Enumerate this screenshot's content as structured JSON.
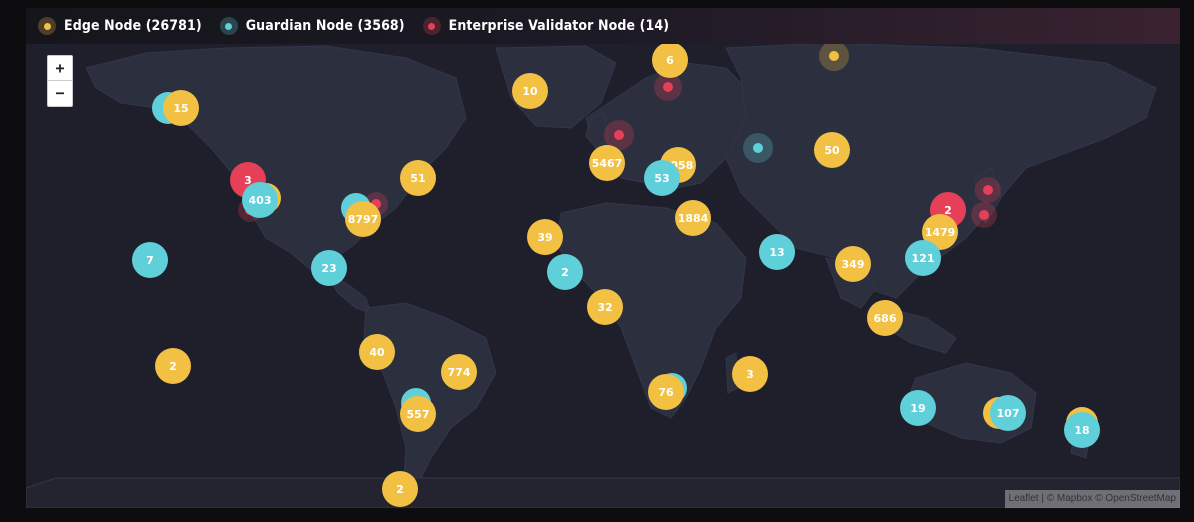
{
  "legend": [
    {
      "label": "Edge Node (26781)",
      "color": "#f2c043",
      "icon": "dot-icon"
    },
    {
      "label": "Guardian Node (3568)",
      "color": "#5fcfd9",
      "icon": "dot-icon"
    },
    {
      "label": "Enterprise Validator Node (14)",
      "color": "#e64058",
      "icon": "dot-icon"
    }
  ],
  "zoom": {
    "in_label": "+",
    "out_label": "−"
  },
  "attribution": {
    "leaflet": "Leaflet",
    "sep": " | © ",
    "mapbox": "Mapbox",
    "osm_prefix": " © ",
    "osm": "OpenStreetMap"
  },
  "colors": {
    "edge": "#f2c043",
    "guardian": "#5fcfd9",
    "validator": "#e64058",
    "land": "#2c2f3e",
    "water": "#1f1f2b"
  },
  "clusters": [
    {
      "label": "15",
      "type": "edge"
    },
    {
      "label": "10",
      "type": "edge"
    },
    {
      "label": "6",
      "type": "edge"
    },
    {
      "label": "3",
      "type": "validator"
    },
    {
      "label": "403",
      "type": "guardian"
    },
    {
      "label": "8797",
      "type": "edge"
    },
    {
      "label": "51",
      "type": "edge"
    },
    {
      "label": "7",
      "type": "guardian"
    },
    {
      "label": "23",
      "type": "guardian"
    },
    {
      "label": "5467",
      "type": "edge"
    },
    {
      "label": "1058",
      "type": "edge"
    },
    {
      "label": "53",
      "type": "guardian"
    },
    {
      "label": "1884",
      "type": "edge"
    },
    {
      "label": "50",
      "type": "edge"
    },
    {
      "label": "39",
      "type": "edge"
    },
    {
      "label": "2",
      "type": "guardian"
    },
    {
      "label": "13",
      "type": "guardian"
    },
    {
      "label": "349",
      "type": "edge"
    },
    {
      "label": "2",
      "type": "validator"
    },
    {
      "label": "1479",
      "type": "edge"
    },
    {
      "label": "121",
      "type": "guardian"
    },
    {
      "label": "32",
      "type": "edge"
    },
    {
      "label": "686",
      "type": "edge"
    },
    {
      "label": "40",
      "type": "edge"
    },
    {
      "label": "774",
      "type": "edge"
    },
    {
      "label": "2",
      "type": "edge"
    },
    {
      "label": "557",
      "type": "edge"
    },
    {
      "label": "76",
      "type": "edge"
    },
    {
      "label": "3",
      "type": "edge"
    },
    {
      "label": "19",
      "type": "guardian"
    },
    {
      "label": "107",
      "type": "guardian"
    },
    {
      "label": "18",
      "type": "guardian"
    },
    {
      "label": "2",
      "type": "edge"
    }
  ]
}
